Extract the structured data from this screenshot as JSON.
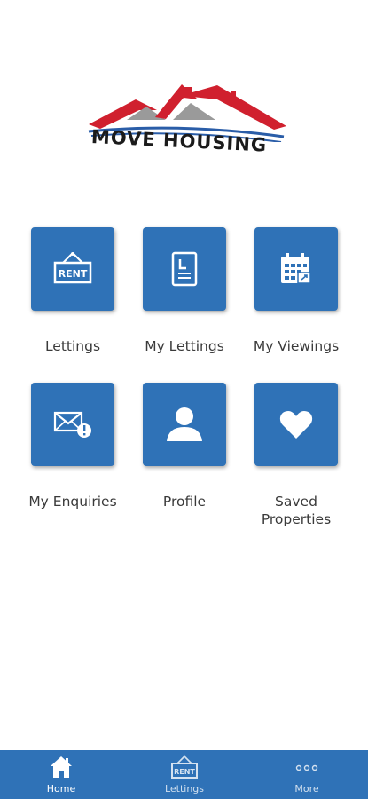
{
  "app": {
    "brand_name": "MOVE HOUSING"
  },
  "tiles": [
    {
      "label": "Lettings",
      "icon": "rent-sign-icon"
    },
    {
      "label": "My Lettings",
      "icon": "document-icon"
    },
    {
      "label": "My Viewings",
      "icon": "calendar-icon"
    },
    {
      "label": "My Enquiries",
      "icon": "envelope-alert-icon"
    },
    {
      "label": "Profile",
      "icon": "user-icon"
    },
    {
      "label": "Saved\nProperties",
      "icon": "heart-icon"
    }
  ],
  "bottom_nav": {
    "items": [
      {
        "label": "Home",
        "icon": "home-icon",
        "active": true
      },
      {
        "label": "Lettings",
        "icon": "rent-sign-icon",
        "active": false
      },
      {
        "label": "More",
        "icon": "more-dots-icon",
        "active": false
      }
    ]
  },
  "colors": {
    "primary": "#2f72b7",
    "roof_red": "#d0202e",
    "roof_gray": "#9a9a9a",
    "text": "#3a3a3a"
  }
}
